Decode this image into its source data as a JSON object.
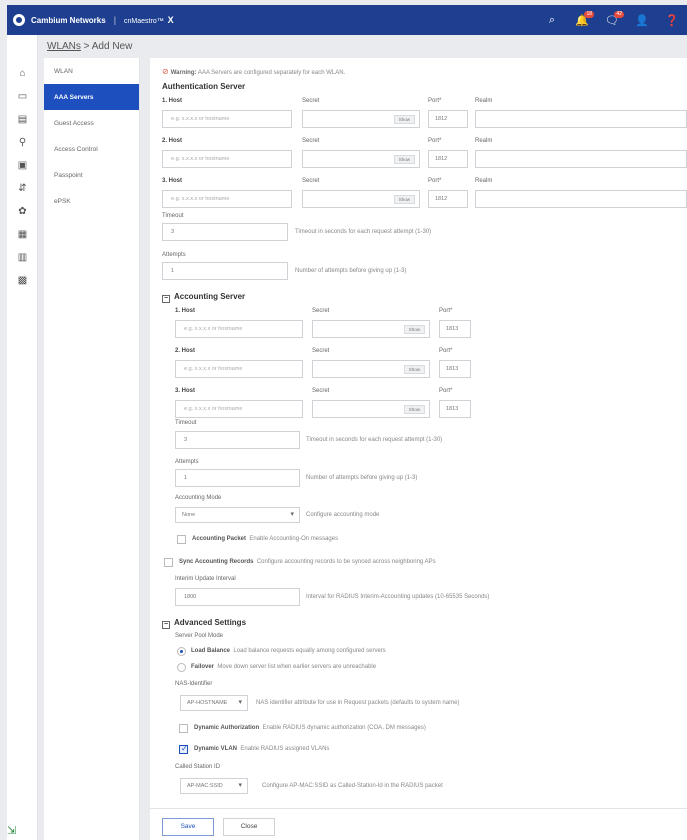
{
  "topbar": {
    "brand": "Cambium Networks",
    "product_prefix": "cnMaestro™",
    "product_suffix": "X",
    "icons": [
      {
        "name": "search-icon",
        "glyph": "⌕",
        "badge": ""
      },
      {
        "name": "alarm-icon",
        "glyph": "🔔",
        "badge": "18"
      },
      {
        "name": "events-icon",
        "glyph": "🗨",
        "badge": "42"
      },
      {
        "name": "user-icon",
        "glyph": "👤",
        "badge": ""
      },
      {
        "name": "help-icon",
        "glyph": "❓",
        "badge": ""
      }
    ]
  },
  "rail": [
    "home-icon",
    "monitor-icon",
    "inventory-icon",
    "location-icon",
    "reports-icon",
    "devices-icon",
    "settings-icon",
    "apps-icon",
    "grid-icon",
    "shield-icon"
  ],
  "breadcrumb": {
    "parent": "WLANs",
    "current": " > Add New"
  },
  "subnav": [
    {
      "label": "WLAN",
      "active": false
    },
    {
      "label": "AAA Servers",
      "active": true
    },
    {
      "label": "Guest Access",
      "active": false
    },
    {
      "label": "Access Control",
      "active": false
    },
    {
      "label": "Passpoint",
      "active": false
    },
    {
      "label": "ePSK",
      "active": false
    }
  ],
  "warning": {
    "prefix": "Warning:",
    "text": " AAA Servers are configured separately for each WLAN."
  },
  "auth": {
    "title": "Authentication Server",
    "hosts": [
      {
        "label": "1. Host",
        "placeholder": "e.g. x.x.x.x or hostname",
        "secret_label": "Secret",
        "show": "Show",
        "port_label": "Port*",
        "port": "1812",
        "realm_label": "Realm"
      },
      {
        "label": "2. Host",
        "placeholder": "e.g. x.x.x.x or hostname",
        "secret_label": "Secret",
        "show": "Show",
        "port_label": "Port*",
        "port": "1812",
        "realm_label": "Realm"
      },
      {
        "label": "3. Host",
        "placeholder": "e.g. x.x.x.x or hostname",
        "secret_label": "Secret",
        "show": "Show",
        "port_label": "Port*",
        "port": "1812",
        "realm_label": "Realm"
      }
    ],
    "timeout": {
      "label": "Timeout",
      "value": "3",
      "help": "Timeout in seconds for each request attempt (1-30)"
    },
    "attempts": {
      "label": "Attempts",
      "value": "1",
      "help": "Number of attempts before giving up (1-3)"
    }
  },
  "acct": {
    "title": "Accounting Server",
    "hosts": [
      {
        "label": "1. Host",
        "placeholder": "e.g. x.x.x.x or hostname",
        "secret_label": "Secret",
        "show": "Show",
        "port_label": "Port*",
        "port": "1813"
      },
      {
        "label": "2. Host",
        "placeholder": "e.g. x.x.x.x or hostname",
        "secret_label": "Secret",
        "show": "Show",
        "port_label": "Port*",
        "port": "1813"
      },
      {
        "label": "3. Host",
        "placeholder": "e.g. x.x.x.x or hostname",
        "secret_label": "Secret",
        "show": "Show",
        "port_label": "Port*",
        "port": "1813"
      }
    ],
    "timeout": {
      "label": "Timeout",
      "value": "3",
      "help": "Timeout in seconds for each request attempt (1-30)"
    },
    "attempts": {
      "label": "Attempts",
      "value": "1",
      "help": "Number of attempts before giving up (1-3)"
    },
    "mode": {
      "label": "Accounting Mode",
      "value": "None",
      "help": "Configure accounting mode"
    },
    "packet": {
      "label": "Accounting Packet",
      "help": "Enable Accounting-On messages",
      "checked": false
    },
    "sync": {
      "label": "Sync Accounting Records",
      "help": "Configure accounting records to be synced across neighboring APs",
      "checked": false
    },
    "interim": {
      "label": "Interim Update Interval",
      "value": "1800",
      "help": "Interval for RADIUS Interim-Accounting updates (10-65535 Seconds)"
    }
  },
  "advanced": {
    "title": "Advanced Settings",
    "host_mode_label": "Server Pool Mode",
    "load_balance": {
      "label": "Load Balance",
      "help": "Load balance requests equally among configured servers",
      "selected": true
    },
    "failover": {
      "label": "Failover",
      "help": "Move down server list when earlier servers are unreachable",
      "selected": false
    },
    "nas": {
      "label": "NAS-Identifier",
      "value": "AP-HOSTNAME",
      "help": "NAS identifier attribute for use in Request packets (defaults to system name)"
    },
    "dyn_auth": {
      "label": "Dynamic Authorization",
      "help": "Enable RADIUS dynamic authorization (COA, DM messages)",
      "checked": false
    },
    "dyn_vlan": {
      "label": "Dynamic VLAN",
      "help": "Enable RADIUS assigned VLANs",
      "checked": true
    },
    "called": {
      "label": "Called Station ID",
      "value": "AP-MAC:SSID",
      "help": "Configure AP-MAC:SSID as Called-Station-Id in the RADIUS packet"
    }
  },
  "footer": {
    "save": "Save",
    "close": "Close"
  }
}
